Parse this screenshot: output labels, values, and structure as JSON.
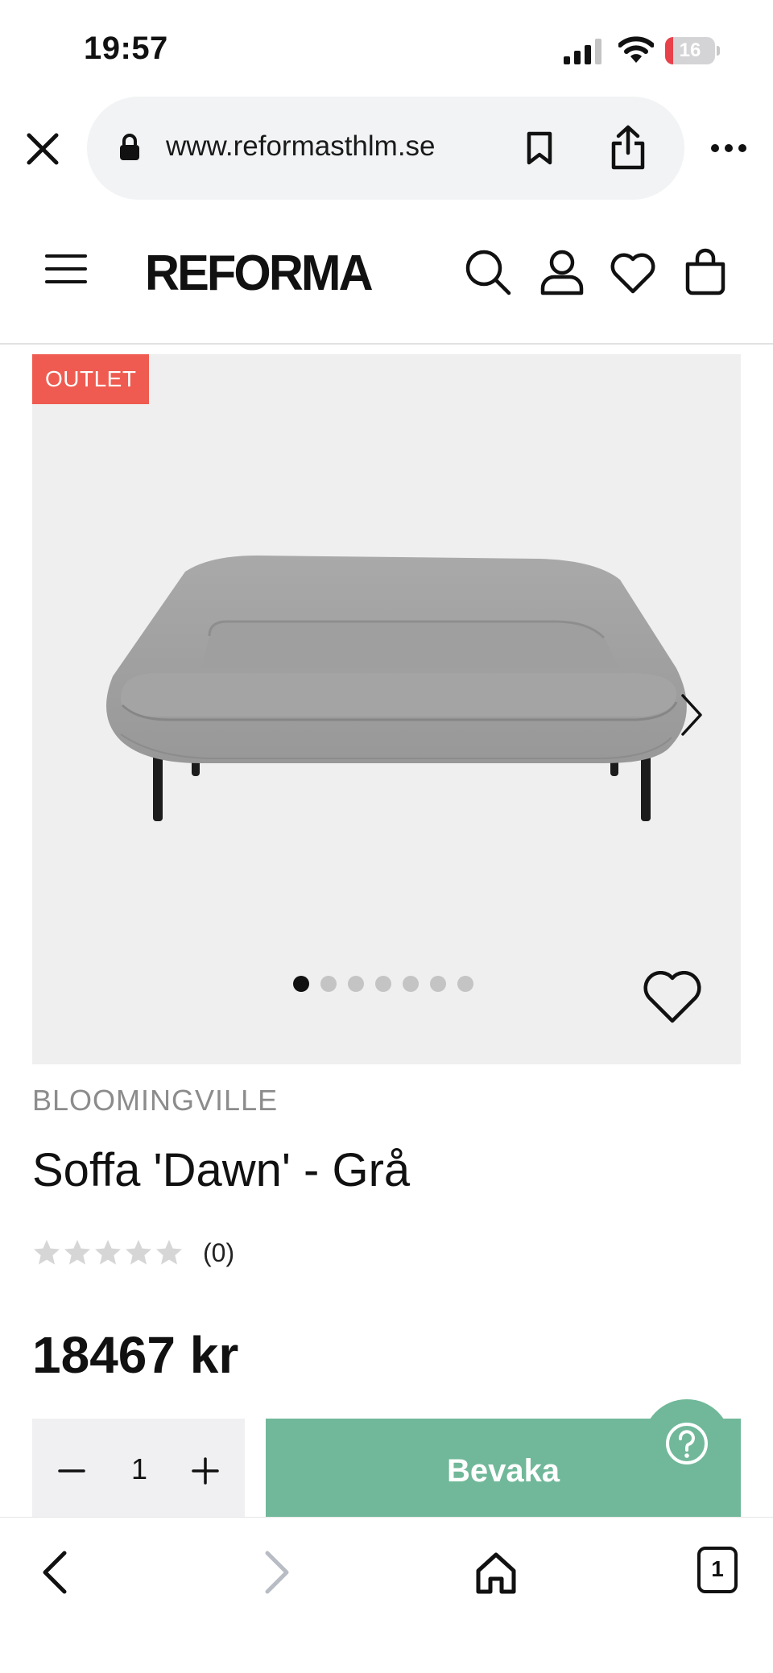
{
  "status_bar": {
    "time": "19:57",
    "battery_level": "16",
    "battery_fraction": 0.16,
    "battery_color": "#e8414a"
  },
  "browser": {
    "url": "www.reformasthlm.se",
    "icons": [
      "close-icon",
      "lock-icon",
      "bookmark-icon",
      "share-icon",
      "more-icon"
    ]
  },
  "site_header": {
    "logo": "REFORMA",
    "icons": [
      "menu-icon",
      "search-icon",
      "account-icon",
      "wishlist-icon",
      "cart-icon"
    ]
  },
  "gallery": {
    "badge": "OUTLET",
    "badge_color": "#ef5b50",
    "image_count": 7,
    "active_index": 0
  },
  "product": {
    "brand": "BLOOMINGVILLE",
    "title": "Soffa 'Dawn' - Grå",
    "rating_stars": 0,
    "rating_max": 5,
    "rating_count": "(0)",
    "price": "18467 kr"
  },
  "purchase": {
    "quantity": "1",
    "cta_label": "Bevaka",
    "cta_color": "#70b899"
  },
  "bottom_toolbar": {
    "tab_count": "1",
    "icons": [
      "back-icon",
      "forward-icon",
      "home-icon",
      "tabs-icon"
    ]
  }
}
